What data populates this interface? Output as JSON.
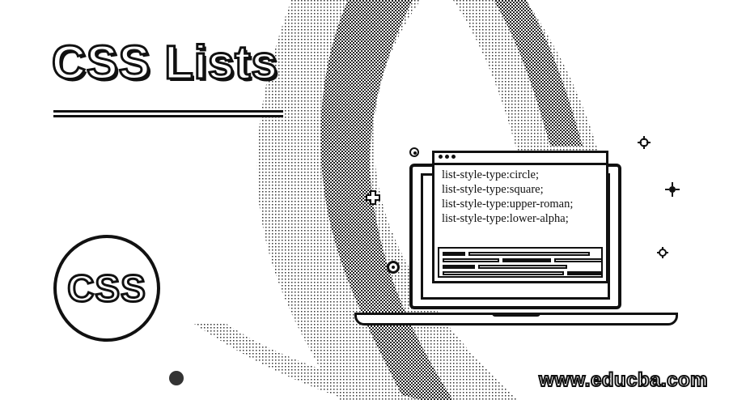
{
  "title": "CSS Lists",
  "badge": {
    "text": "CSS"
  },
  "code_window": {
    "lines": [
      "list-style-type:circle;",
      "list-style-type:square;",
      "list-style-type:upper-roman;",
      "list-style-type:lower-alpha;"
    ]
  },
  "watermark": "www.educba.com",
  "colors": {
    "ink": "#111111",
    "background": "#ffffff"
  },
  "icons": [
    "plus-icon",
    "crosshair-icon",
    "ring-icon",
    "laptop-icon"
  ]
}
